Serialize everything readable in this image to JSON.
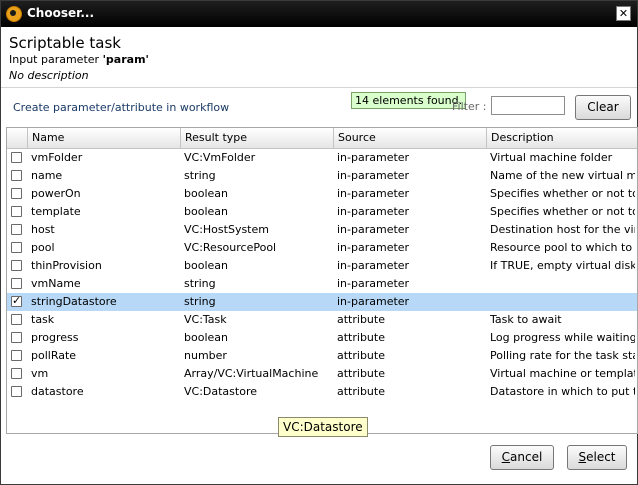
{
  "window": {
    "title": "Chooser..."
  },
  "header": {
    "title": "Scriptable task",
    "input_parameter_label": "Input parameter",
    "input_parameter_value": "'param'",
    "description": "No description"
  },
  "toolbar": {
    "create_link": "Create parameter/attribute in workflow",
    "found_badge": "14 elements found.",
    "filter_label": "Filter :",
    "filter_value": "",
    "clear_label": "Clear"
  },
  "table": {
    "columns": [
      "Name",
      "Result type",
      "Source",
      "Description"
    ],
    "rows": [
      {
        "checked": false,
        "name": "vmFolder",
        "type": "VC:VmFolder",
        "source": "in-parameter",
        "description": "Virtual machine folder"
      },
      {
        "checked": false,
        "name": "name",
        "type": "string",
        "source": "in-parameter",
        "description": "Name of the new virtual mac..."
      },
      {
        "checked": false,
        "name": "powerOn",
        "type": "boolean",
        "source": "in-parameter",
        "description": "Specifies whether or not to ..."
      },
      {
        "checked": false,
        "name": "template",
        "type": "boolean",
        "source": "in-parameter",
        "description": "Specifies whether or not to ..."
      },
      {
        "checked": false,
        "name": "host",
        "type": "VC:HostSystem",
        "source": "in-parameter",
        "description": "Destination host for the virtu..."
      },
      {
        "checked": false,
        "name": "pool",
        "type": "VC:ResourcePool",
        "source": "in-parameter",
        "description": "Resource pool to which to at..."
      },
      {
        "checked": false,
        "name": "thinProvision",
        "type": "boolean",
        "source": "in-parameter",
        "description": "If TRUE, empty virtual disk sp..."
      },
      {
        "checked": false,
        "name": "vmName",
        "type": "string",
        "source": "in-parameter",
        "description": ""
      },
      {
        "checked": true,
        "name": "stringDatastore",
        "type": "string",
        "source": "in-parameter",
        "description": ""
      },
      {
        "checked": false,
        "name": "task",
        "type": "VC:Task",
        "source": "attribute",
        "description": "Task to await"
      },
      {
        "checked": false,
        "name": "progress",
        "type": "boolean",
        "source": "attribute",
        "description": "Log progress while waiting f..."
      },
      {
        "checked": false,
        "name": "pollRate",
        "type": "number",
        "source": "attribute",
        "description": "Polling rate for the task state..."
      },
      {
        "checked": false,
        "name": "vm",
        "type": "Array/VC:VirtualMachine",
        "source": "attribute",
        "description": "Virtual machine or template t..."
      },
      {
        "checked": false,
        "name": "datastore",
        "type": "VC:Datastore",
        "source": "attribute",
        "description": "Datastore in which to put the..."
      }
    ],
    "selected_row_color": "#b7d9f7"
  },
  "tooltip": {
    "text": "VC:Datastore"
  },
  "footer": {
    "cancel_mnemonic": "C",
    "cancel_rest": "ancel",
    "select_mnemonic": "S",
    "select_rest": "elect"
  }
}
